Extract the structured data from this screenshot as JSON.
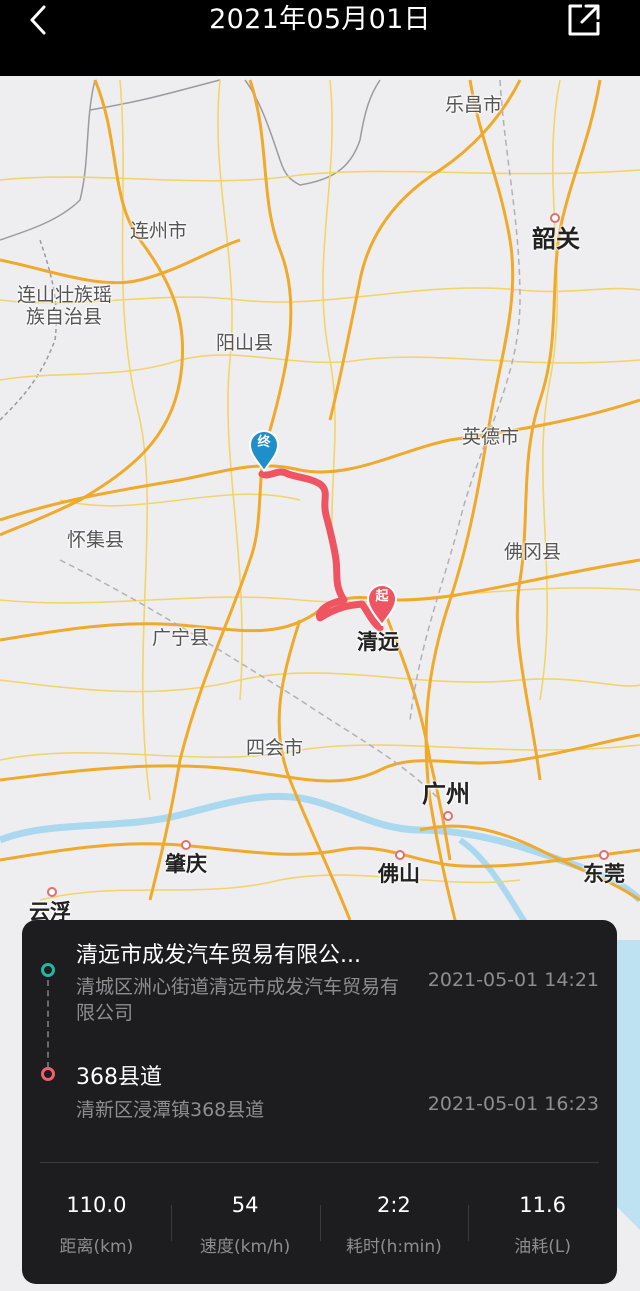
{
  "header": {
    "title": "2021年05月01日"
  },
  "map": {
    "cities": [
      {
        "name": "乐昌市"
      },
      {
        "name": "连州市"
      },
      {
        "name": "韶关"
      },
      {
        "name": "连山壮族瑶"
      },
      {
        "name": "族自治县"
      },
      {
        "name": "阳山县"
      },
      {
        "name": "英德市"
      },
      {
        "name": "怀集县"
      },
      {
        "name": "佛冈县"
      },
      {
        "name": "广宁县"
      },
      {
        "name": "清远"
      },
      {
        "name": "四会市"
      },
      {
        "name": "广州"
      },
      {
        "name": "肇庆"
      },
      {
        "name": "佛山"
      },
      {
        "name": "东莞"
      },
      {
        "name": "云浮"
      }
    ],
    "start_pin_label": "起",
    "end_pin_label": "终",
    "route_color": "#ef5462"
  },
  "trip": {
    "start": {
      "name": "清远市成发汽车贸易有限公...",
      "address": "清城区洲心街道清远市成发汽车贸易有限公司",
      "time": "2021-05-01 14:21"
    },
    "end": {
      "name": "368县道",
      "address": "清新区浸潭镇368县道",
      "time": "2021-05-01 16:23"
    },
    "stats": [
      {
        "value": "110.0",
        "label": "距离(km)"
      },
      {
        "value": "54",
        "label": "速度(km/h)"
      },
      {
        "value": "2:2",
        "label": "耗时(h:min)"
      },
      {
        "value": "11.6",
        "label": "油耗(L)"
      }
    ]
  },
  "colors": {
    "start_dot": "#21b8a5",
    "end_dot": "#f0606e",
    "card_bg": "#1d1d1f"
  }
}
